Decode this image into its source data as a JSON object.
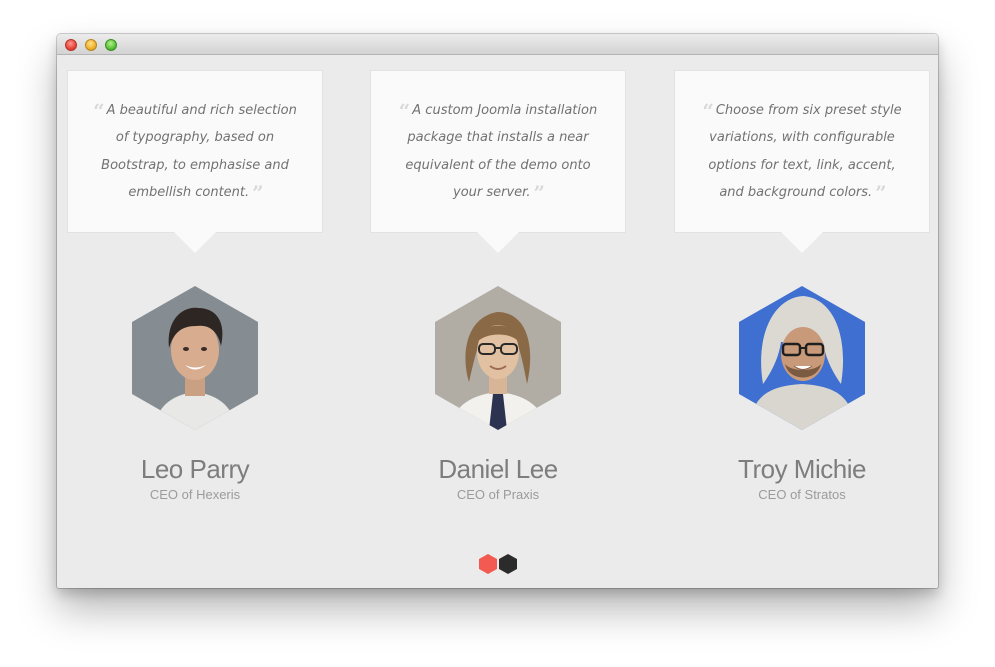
{
  "window": {
    "controls": {
      "close_icon": "close-traffic-light-icon",
      "minimize_icon": "minimize-traffic-light-icon",
      "zoom_icon": "zoom-traffic-light-icon"
    }
  },
  "testimonials": [
    {
      "quote": "A beautiful and rich selection of typography, based on Bootstrap, to emphasise and embellish content.",
      "name": "Leo Parry",
      "role": "CEO of Hexeris",
      "avatar_background": "#7b848a"
    },
    {
      "quote": "A custom Joomla installation package that installs a near equivalent of the demo onto your server.",
      "name": "Daniel Lee",
      "role": "CEO of Praxis",
      "avatar_background": "#b1aca4"
    },
    {
      "quote": "Choose from six preset style variations, with configurable options for text, link, accent, and background colors.",
      "name": "Troy Michie",
      "role": "CEO of Stratos",
      "avatar_background": "#3f6fd0"
    }
  ],
  "quote_marks": {
    "open": "“",
    "close": "”"
  },
  "pager": {
    "total_pages": 2,
    "active_page": 1,
    "active_color": "#f25a52",
    "inactive_color": "#2b2b2b"
  },
  "colors": {
    "panel_background": "#ebebeb",
    "card_background": "#fafafa",
    "name_text": "#7d7d7d",
    "quote_text": "#727272"
  }
}
